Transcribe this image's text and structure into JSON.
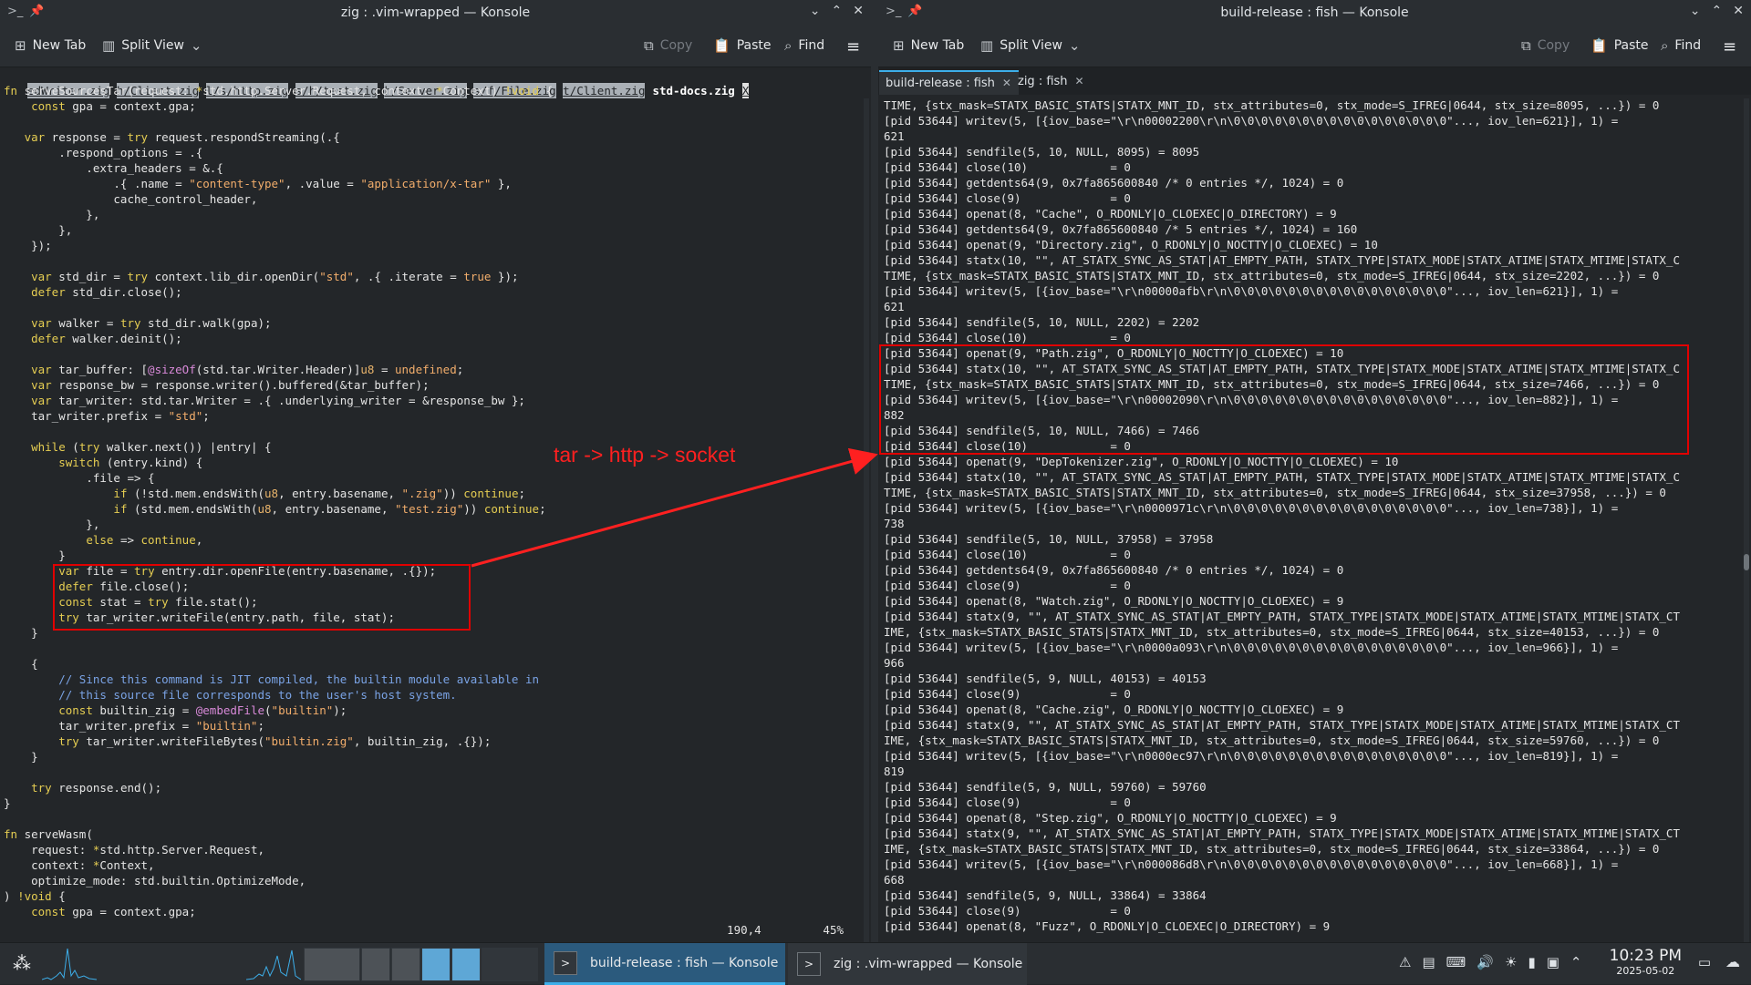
{
  "left_window": {
    "title": "zig : .vim-wrapped — Konsole",
    "toolbar": {
      "new_tab": "New Tab",
      "split_view": "Split View",
      "copy": "Copy",
      "paste": "Paste",
      "find": "Find"
    },
    "vim_tabs": [
      "edWriter.zig",
      "h/Client.zig",
      "l/s/http.zig",
      "s/h/test.zig",
      "h/Server.zig",
      "s/f/File.zig",
      "t/Client.zig"
    ],
    "vim_active_tab": "std-docs.zig",
    "vim_tab_extra": "X",
    "code": [
      [
        [
          "fn",
          "kw"
        ],
        [
          " serveSourcesTar(request: ",
          "fn"
        ],
        [
          "*",
          "kw"
        ],
        [
          "std.http.Server.Request, context: ",
          "fn"
        ],
        [
          "*",
          "kw"
        ],
        [
          "Context) ",
          "fn"
        ],
        [
          "!void",
          "kw"
        ],
        [
          " {",
          "fn"
        ]
      ],
      [
        [
          "    ",
          "fn"
        ],
        [
          "const",
          "kw"
        ],
        [
          " gpa = context.gpa;",
          "fn"
        ]
      ],
      [
        [
          "",
          "fn"
        ]
      ],
      [
        [
          "   ",
          "fn"
        ],
        [
          "var",
          "kw"
        ],
        [
          " response = ",
          "fn"
        ],
        [
          "try",
          "kw"
        ],
        [
          " request.respondStreaming(.{",
          "fn"
        ]
      ],
      [
        [
          "        .respond_options = .{",
          "fn"
        ]
      ],
      [
        [
          "            .extra_headers = &.{",
          "fn"
        ]
      ],
      [
        [
          "                .{ .name = ",
          "fn"
        ],
        [
          "\"content-type\"",
          "st"
        ],
        [
          ", .value = ",
          "fn"
        ],
        [
          "\"application/x-tar\"",
          "st"
        ],
        [
          " },",
          "fn"
        ]
      ],
      [
        [
          "                cache_control_header,",
          "fn"
        ]
      ],
      [
        [
          "            },",
          "fn"
        ]
      ],
      [
        [
          "        },",
          "fn"
        ]
      ],
      [
        [
          "    });",
          "fn"
        ]
      ],
      [
        [
          "",
          "fn"
        ]
      ],
      [
        [
          "    ",
          "fn"
        ],
        [
          "var",
          "kw"
        ],
        [
          " std_dir = ",
          "fn"
        ],
        [
          "try",
          "kw"
        ],
        [
          " context.lib_dir.openDir(",
          "fn"
        ],
        [
          "\"std\"",
          "st"
        ],
        [
          ", .{ .iterate = ",
          "fn"
        ],
        [
          "true",
          "st"
        ],
        [
          " });",
          "fn"
        ]
      ],
      [
        [
          "    ",
          "fn"
        ],
        [
          "defer",
          "kw"
        ],
        [
          " std_dir.close();",
          "fn"
        ]
      ],
      [
        [
          "",
          "fn"
        ]
      ],
      [
        [
          "    ",
          "fn"
        ],
        [
          "var",
          "kw"
        ],
        [
          " walker = ",
          "fn"
        ],
        [
          "try",
          "kw"
        ],
        [
          " std_dir.walk(gpa);",
          "fn"
        ]
      ],
      [
        [
          "    ",
          "fn"
        ],
        [
          "defer",
          "kw"
        ],
        [
          " walker.deinit();",
          "fn"
        ]
      ],
      [
        [
          "",
          "fn"
        ]
      ],
      [
        [
          "    ",
          "fn"
        ],
        [
          "var",
          "kw"
        ],
        [
          " tar_buffer: [",
          "fn"
        ],
        [
          "@sizeOf",
          "pp"
        ],
        [
          "(std.tar.Writer.Header)]",
          "fn"
        ],
        [
          "u8",
          "ty"
        ],
        [
          " = ",
          "fn"
        ],
        [
          "undefined",
          "st"
        ],
        [
          ";",
          "fn"
        ]
      ],
      [
        [
          "    ",
          "fn"
        ],
        [
          "var",
          "kw"
        ],
        [
          " response_bw = response.writer().buffered(&tar_buffer);",
          "fn"
        ]
      ],
      [
        [
          "    ",
          "fn"
        ],
        [
          "var",
          "kw"
        ],
        [
          " tar_writer: std.tar.Writer = .{ .underlying_writer = &response_bw };",
          "fn"
        ]
      ],
      [
        [
          "    tar_writer.prefix = ",
          "fn"
        ],
        [
          "\"std\"",
          "st"
        ],
        [
          ";",
          "fn"
        ]
      ],
      [
        [
          "",
          "fn"
        ]
      ],
      [
        [
          "    ",
          "fn"
        ],
        [
          "while",
          "kw"
        ],
        [
          " (",
          "fn"
        ],
        [
          "try",
          "kw"
        ],
        [
          " walker.next()) |entry| {",
          "fn"
        ]
      ],
      [
        [
          "        ",
          "fn"
        ],
        [
          "switch",
          "kw"
        ],
        [
          " (entry.kind) {",
          "fn"
        ]
      ],
      [
        [
          "            .file => {",
          "fn"
        ]
      ],
      [
        [
          "                ",
          "fn"
        ],
        [
          "if",
          "kw"
        ],
        [
          " (!std.mem.endsWith(",
          "fn"
        ],
        [
          "u8",
          "ty"
        ],
        [
          ", entry.basename, ",
          "fn"
        ],
        [
          "\".zig\"",
          "st"
        ],
        [
          ")) ",
          "fn"
        ],
        [
          "continue",
          "kw"
        ],
        [
          ";",
          "fn"
        ]
      ],
      [
        [
          "                ",
          "fn"
        ],
        [
          "if",
          "kw"
        ],
        [
          " (std.mem.endsWith(",
          "fn"
        ],
        [
          "u8",
          "ty"
        ],
        [
          ", entry.basename, ",
          "fn"
        ],
        [
          "\"test.zig\"",
          "st"
        ],
        [
          ")) ",
          "fn"
        ],
        [
          "continue",
          "kw"
        ],
        [
          ";",
          "fn"
        ]
      ],
      [
        [
          "            },",
          "fn"
        ]
      ],
      [
        [
          "            ",
          "fn"
        ],
        [
          "else",
          "kw"
        ],
        [
          " => ",
          "fn"
        ],
        [
          "continue",
          "kw"
        ],
        [
          ",",
          "fn"
        ]
      ],
      [
        [
          "        }",
          "fn"
        ]
      ],
      [
        [
          "        ",
          "fn"
        ],
        [
          "var",
          "kw"
        ],
        [
          " file = ",
          "fn"
        ],
        [
          "try",
          "kw"
        ],
        [
          " entry.dir.openFile(entry.basename, .{});",
          "fn"
        ]
      ],
      [
        [
          "        ",
          "fn"
        ],
        [
          "defer",
          "kw"
        ],
        [
          " file.close();",
          "fn"
        ]
      ],
      [
        [
          "        ",
          "fn"
        ],
        [
          "const",
          "kw"
        ],
        [
          " stat = ",
          "fn"
        ],
        [
          "try",
          "kw"
        ],
        [
          " file.stat();",
          "fn"
        ]
      ],
      [
        [
          "        ",
          "fn"
        ],
        [
          "try",
          "kw"
        ],
        [
          " tar_writer.writeFile(entry.path, file, stat);",
          "fn"
        ]
      ],
      [
        [
          "    }",
          "fn"
        ]
      ],
      [
        [
          "",
          "fn"
        ]
      ],
      [
        [
          "    {",
          "fn"
        ]
      ],
      [
        [
          "        ",
          "fn"
        ],
        [
          "// Since this command is JIT compiled, the builtin module available in",
          "cm"
        ]
      ],
      [
        [
          "        ",
          "fn"
        ],
        [
          "// this source file corresponds to the user's host system.",
          "cm"
        ]
      ],
      [
        [
          "        ",
          "fn"
        ],
        [
          "const",
          "kw"
        ],
        [
          " builtin_zig = ",
          "fn"
        ],
        [
          "@embedFile",
          "pp"
        ],
        [
          "(",
          "fn"
        ],
        [
          "\"builtin\"",
          "st"
        ],
        [
          ");",
          "fn"
        ]
      ],
      [
        [
          "        tar_writer.prefix = ",
          "fn"
        ],
        [
          "\"builtin\"",
          "st"
        ],
        [
          ";",
          "fn"
        ]
      ],
      [
        [
          "        ",
          "fn"
        ],
        [
          "try",
          "kw"
        ],
        [
          " tar_writer.writeFileBytes(",
          "fn"
        ],
        [
          "\"builtin.zig\"",
          "st"
        ],
        [
          ", builtin_zig, .{});",
          "fn"
        ]
      ],
      [
        [
          "    }",
          "fn"
        ]
      ],
      [
        [
          "",
          "fn"
        ]
      ],
      [
        [
          "    ",
          "fn"
        ],
        [
          "try",
          "kw"
        ],
        [
          " response.end();",
          "fn"
        ]
      ],
      [
        [
          "}",
          "fn"
        ]
      ],
      [
        [
          "",
          "fn"
        ]
      ],
      [
        [
          "fn",
          "kw"
        ],
        [
          " serveWasm(",
          "fn"
        ]
      ],
      [
        [
          "    request: ",
          "fn"
        ],
        [
          "*",
          "kw"
        ],
        [
          "std.http.Server.Request,",
          "fn"
        ]
      ],
      [
        [
          "    context: ",
          "fn"
        ],
        [
          "*",
          "kw"
        ],
        [
          "Context,",
          "fn"
        ]
      ],
      [
        [
          "    optimize_mode: std.builtin.OptimizeMode,",
          "fn"
        ]
      ],
      [
        [
          ") ",
          "fn"
        ],
        [
          "!void",
          "kw"
        ],
        [
          " {",
          "fn"
        ]
      ],
      [
        [
          "    ",
          "fn"
        ],
        [
          "const",
          "kw"
        ],
        [
          " gpa = context.gpa;",
          "fn"
        ]
      ]
    ],
    "status_pos": "190,4",
    "status_pct": "45%"
  },
  "right_window": {
    "title": "build-release : fish — Konsole",
    "toolbar": {
      "new_tab": "New Tab",
      "split_view": "Split View",
      "copy": "Copy",
      "paste": "Paste",
      "find": "Find"
    },
    "tabs": [
      "build-release : fish",
      "zig : fish"
    ],
    "lines": [
      "TIME, {stx_mask=STATX_BASIC_STATS|STATX_MNT_ID, stx_attributes=0, stx_mode=S_IFREG|0644, stx_size=8095, ...}) = 0",
      "[pid 53644] writev(5, [{iov_base=\"\\r\\n00002200\\r\\n\\0\\0\\0\\0\\0\\0\\0\\0\\0\\0\\0\\0\\0\\0\\0\\0\"..., iov_len=621}], 1) =",
      "621",
      "[pid 53644] sendfile(5, 10, NULL, 8095) = 8095",
      "[pid 53644] close(10)            = 0",
      "[pid 53644] getdents64(9, 0x7fa865600840 /* 0 entries */, 1024) = 0",
      "[pid 53644] close(9)             = 0",
      "[pid 53644] openat(8, \"Cache\", O_RDONLY|O_CLOEXEC|O_DIRECTORY) = 9",
      "[pid 53644] getdents64(9, 0x7fa865600840 /* 5 entries */, 1024) = 160",
      "[pid 53644] openat(9, \"Directory.zig\", O_RDONLY|O_NOCTTY|O_CLOEXEC) = 10",
      "[pid 53644] statx(10, \"\", AT_STATX_SYNC_AS_STAT|AT_EMPTY_PATH, STATX_TYPE|STATX_MODE|STATX_ATIME|STATX_MTIME|STATX_C",
      "TIME, {stx_mask=STATX_BASIC_STATS|STATX_MNT_ID, stx_attributes=0, stx_mode=S_IFREG|0644, stx_size=2202, ...}) = 0",
      "[pid 53644] writev(5, [{iov_base=\"\\r\\n00000afb\\r\\n\\0\\0\\0\\0\\0\\0\\0\\0\\0\\0\\0\\0\\0\\0\\0\\0\"..., iov_len=621}], 1) =",
      "621",
      "[pid 53644] sendfile(5, 10, NULL, 2202) = 2202",
      "[pid 53644] close(10)            = 0",
      "[pid 53644] openat(9, \"Path.zig\", O_RDONLY|O_NOCTTY|O_CLOEXEC) = 10",
      "[pid 53644] statx(10, \"\", AT_STATX_SYNC_AS_STAT|AT_EMPTY_PATH, STATX_TYPE|STATX_MODE|STATX_ATIME|STATX_MTIME|STATX_C",
      "TIME, {stx_mask=STATX_BASIC_STATS|STATX_MNT_ID, stx_attributes=0, stx_mode=S_IFREG|0644, stx_size=7466, ...}) = 0",
      "[pid 53644] writev(5, [{iov_base=\"\\r\\n00002090\\r\\n\\0\\0\\0\\0\\0\\0\\0\\0\\0\\0\\0\\0\\0\\0\\0\\0\"..., iov_len=882}], 1) =",
      "882",
      "[pid 53644] sendfile(5, 10, NULL, 7466) = 7466",
      "[pid 53644] close(10)            = 0",
      "[pid 53644] openat(9, \"DepTokenizer.zig\", O_RDONLY|O_NOCTTY|O_CLOEXEC) = 10",
      "[pid 53644] statx(10, \"\", AT_STATX_SYNC_AS_STAT|AT_EMPTY_PATH, STATX_TYPE|STATX_MODE|STATX_ATIME|STATX_MTIME|STATX_C",
      "TIME, {stx_mask=STATX_BASIC_STATS|STATX_MNT_ID, stx_attributes=0, stx_mode=S_IFREG|0644, stx_size=37958, ...}) = 0",
      "[pid 53644] writev(5, [{iov_base=\"\\r\\n0000971c\\r\\n\\0\\0\\0\\0\\0\\0\\0\\0\\0\\0\\0\\0\\0\\0\\0\\0\"..., iov_len=738}], 1) =",
      "738",
      "[pid 53644] sendfile(5, 10, NULL, 37958) = 37958",
      "[pid 53644] close(10)            = 0",
      "[pid 53644] getdents64(9, 0x7fa865600840 /* 0 entries */, 1024) = 0",
      "[pid 53644] close(9)             = 0",
      "[pid 53644] openat(8, \"Watch.zig\", O_RDONLY|O_NOCTTY|O_CLOEXEC) = 9",
      "[pid 53644] statx(9, \"\", AT_STATX_SYNC_AS_STAT|AT_EMPTY_PATH, STATX_TYPE|STATX_MODE|STATX_ATIME|STATX_MTIME|STATX_CT",
      "IME, {stx_mask=STATX_BASIC_STATS|STATX_MNT_ID, stx_attributes=0, stx_mode=S_IFREG|0644, stx_size=40153, ...}) = 0",
      "[pid 53644] writev(5, [{iov_base=\"\\r\\n0000a093\\r\\n\\0\\0\\0\\0\\0\\0\\0\\0\\0\\0\\0\\0\\0\\0\\0\\0\"..., iov_len=966}], 1) =",
      "966",
      "[pid 53644] sendfile(5, 9, NULL, 40153) = 40153",
      "[pid 53644] close(9)             = 0",
      "[pid 53644] openat(8, \"Cache.zig\", O_RDONLY|O_NOCTTY|O_CLOEXEC) = 9",
      "[pid 53644] statx(9, \"\", AT_STATX_SYNC_AS_STAT|AT_EMPTY_PATH, STATX_TYPE|STATX_MODE|STATX_ATIME|STATX_MTIME|STATX_CT",
      "IME, {stx_mask=STATX_BASIC_STATS|STATX_MNT_ID, stx_attributes=0, stx_mode=S_IFREG|0644, stx_size=59760, ...}) = 0",
      "[pid 53644] writev(5, [{iov_base=\"\\r\\n0000ec97\\r\\n\\0\\0\\0\\0\\0\\0\\0\\0\\0\\0\\0\\0\\0\\0\\0\\0\"..., iov_len=819}], 1) =",
      "819",
      "[pid 53644] sendfile(5, 9, NULL, 59760) = 59760",
      "[pid 53644] close(9)             = 0",
      "[pid 53644] openat(8, \"Step.zig\", O_RDONLY|O_NOCTTY|O_CLOEXEC) = 9",
      "[pid 53644] statx(9, \"\", AT_STATX_SYNC_AS_STAT|AT_EMPTY_PATH, STATX_TYPE|STATX_MODE|STATX_ATIME|STATX_MTIME|STATX_CT",
      "IME, {stx_mask=STATX_BASIC_STATS|STATX_MNT_ID, stx_attributes=0, stx_mode=S_IFREG|0644, stx_size=33864, ...}) = 0",
      "[pid 53644] writev(5, [{iov_base=\"\\r\\n000086d8\\r\\n\\0\\0\\0\\0\\0\\0\\0\\0\\0\\0\\0\\0\\0\\0\\0\\0\"..., iov_len=668}], 1) =",
      "668",
      "[pid 53644] sendfile(5, 9, NULL, 33864) = 33864",
      "[pid 53644] close(9)             = 0",
      "[pid 53644] openat(8, \"Fuzz\", O_RDONLY|O_CLOEXEC|O_DIRECTORY) = 9"
    ]
  },
  "annotation": {
    "label": "tar -> http -> socket",
    "color": "#ff2020"
  },
  "taskbar": {
    "tasks": [
      "build-release : fish — Konsole",
      "zig : .vim-wrapped — Konsole"
    ],
    "clock_time": "10:23 PM",
    "clock_date": "2025-05-02"
  },
  "colors": {
    "accent": "#3daee9",
    "annotation_red": "#e00000"
  }
}
